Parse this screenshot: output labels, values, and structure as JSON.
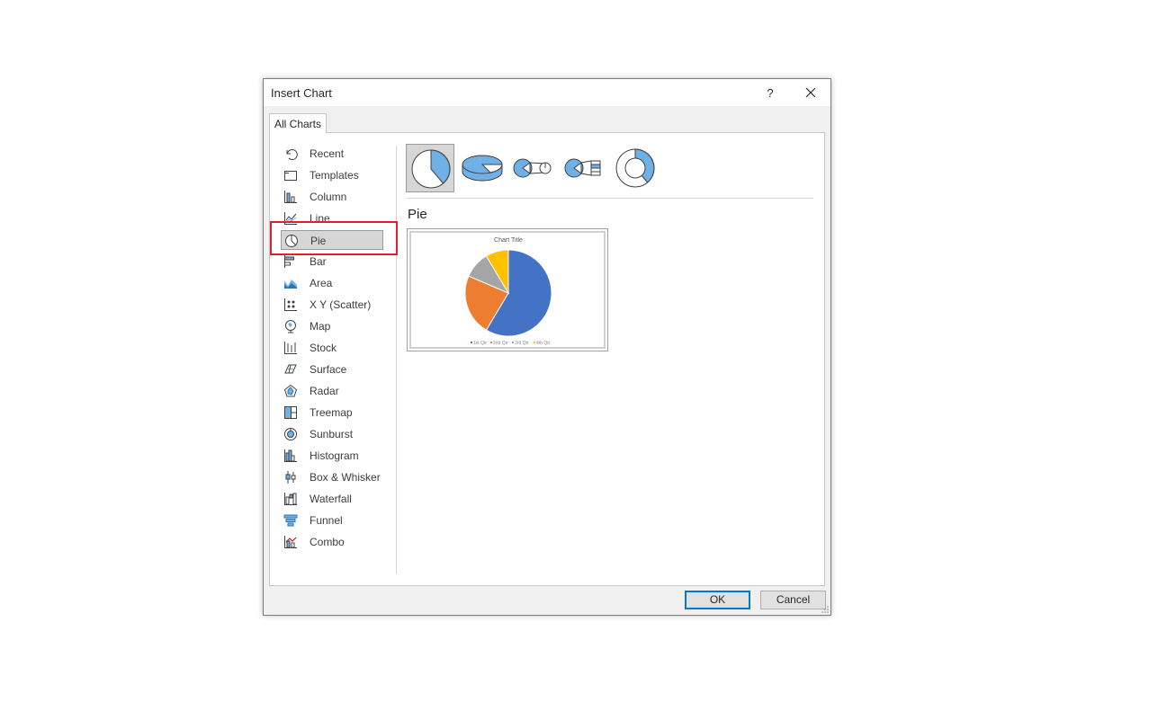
{
  "dialog": {
    "title": "Insert Chart",
    "help": "?",
    "tab": "All Charts",
    "section_title": "Pie",
    "ok": "OK",
    "cancel": "Cancel"
  },
  "sidebar": {
    "items": [
      {
        "label": "Recent",
        "icon": "recent-icon"
      },
      {
        "label": "Templates",
        "icon": "templates-icon"
      },
      {
        "label": "Column",
        "icon": "column-icon"
      },
      {
        "label": "Line",
        "icon": "line-icon"
      },
      {
        "label": "Pie",
        "icon": "pie-icon",
        "selected": true
      },
      {
        "label": "Bar",
        "icon": "bar-icon"
      },
      {
        "label": "Area",
        "icon": "area-icon"
      },
      {
        "label": "X Y (Scatter)",
        "icon": "scatter-icon"
      },
      {
        "label": "Map",
        "icon": "map-icon"
      },
      {
        "label": "Stock",
        "icon": "stock-icon"
      },
      {
        "label": "Surface",
        "icon": "surface-icon"
      },
      {
        "label": "Radar",
        "icon": "radar-icon"
      },
      {
        "label": "Treemap",
        "icon": "treemap-icon"
      },
      {
        "label": "Sunburst",
        "icon": "sunburst-icon"
      },
      {
        "label": "Histogram",
        "icon": "histogram-icon"
      },
      {
        "label": "Box & Whisker",
        "icon": "box-whisker-icon"
      },
      {
        "label": "Waterfall",
        "icon": "waterfall-icon"
      },
      {
        "label": "Funnel",
        "icon": "funnel-icon"
      },
      {
        "label": "Combo",
        "icon": "combo-icon"
      }
    ]
  },
  "subtypes": [
    {
      "name": "pie",
      "selected": true
    },
    {
      "name": "3d-pie"
    },
    {
      "name": "pie-of-pie"
    },
    {
      "name": "bar-of-pie"
    },
    {
      "name": "doughnut"
    }
  ],
  "preview": {
    "chart_title": "Chart Title",
    "legend": [
      "1st Qtr",
      "2nd Qtr",
      "3rd Qtr",
      "4th Qtr"
    ]
  },
  "chart_data": {
    "type": "pie",
    "title": "Chart Title",
    "categories": [
      "1st Qtr",
      "2nd Qtr",
      "3rd Qtr",
      "4th Qtr"
    ],
    "values": [
      8.2,
      3.2,
      1.4,
      1.2
    ],
    "colors": [
      "#4472c4",
      "#ed7d31",
      "#a5a5a5",
      "#ffc000"
    ]
  },
  "colors": {
    "accent": "#0078d7",
    "highlight_box": "#e0202a",
    "icon_blue": "#6fb1e6"
  }
}
